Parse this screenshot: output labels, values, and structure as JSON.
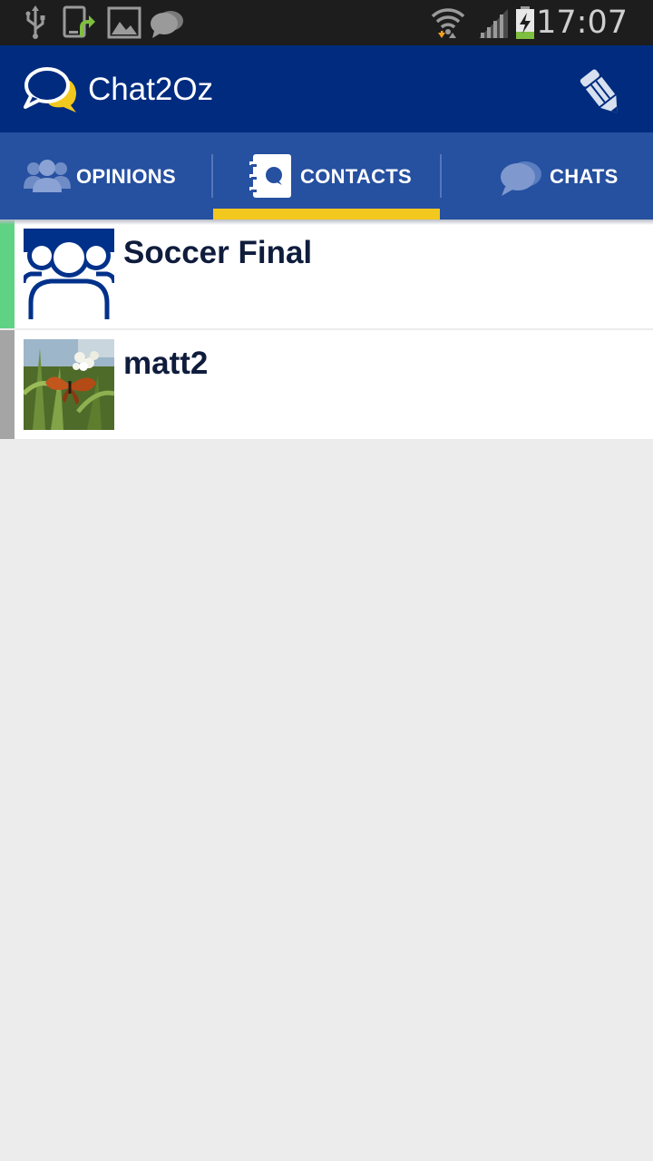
{
  "status_bar": {
    "time": "17:07",
    "icons": [
      "usb-icon",
      "phone-update-icon",
      "picture-icon",
      "chat-notification-icon",
      "wifi-icon",
      "signal-icon",
      "battery-charging-icon"
    ]
  },
  "app_bar": {
    "title": "Chat2Oz",
    "logo_icon": "chat-bubbles-logo-icon",
    "compose_icon": "pencil-icon"
  },
  "tabs": [
    {
      "label": "OPINIONS",
      "icon": "people-icon",
      "selected": false
    },
    {
      "label": "CONTACTS",
      "icon": "address-book-icon",
      "selected": true
    },
    {
      "label": "CHATS",
      "icon": "chat-bubbles-icon",
      "selected": false
    }
  ],
  "contacts": [
    {
      "name": "Soccer Final",
      "avatar": "group-icon",
      "accent_color": "#5fd283"
    },
    {
      "name": "matt2",
      "avatar": "butterfly-photo",
      "accent_color": "#a5a5a5"
    }
  ],
  "colors": {
    "status_bar": "#1d1d1d",
    "app_bar": "#002b7f",
    "tab_bar": "#2650a0",
    "tab_indicator": "#f3c81e",
    "background": "#ececec"
  }
}
